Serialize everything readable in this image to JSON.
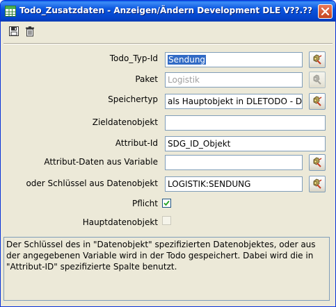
{
  "window": {
    "title": "Todo_Zusatzdaten - Anzeigen/Ändern Development DLE V??.??"
  },
  "toolbar": {
    "save_icon": "save-icon",
    "delete_icon": "trash-icon"
  },
  "form": {
    "todo_typ_id": {
      "label": "Todo_Typ-Id",
      "value": "Sendung"
    },
    "paket": {
      "label": "Paket",
      "value": "Logistik"
    },
    "speichertyp": {
      "label": "Speichertyp",
      "value": "als Hauptobjekt in DLETODO - D"
    },
    "zieldatenobjekt": {
      "label": "Zieldatenobjekt",
      "value": ""
    },
    "attribut_id": {
      "label": "Attribut-Id",
      "value": "SDG_ID_Objekt"
    },
    "attribut_daten": {
      "label": "Attribut-Daten aus Variable",
      "value": ""
    },
    "schluessel": {
      "label": "oder Schlüssel aus Datenobjekt",
      "value": "LOGISTIK:SENDUNG"
    },
    "pflicht": {
      "label": "Pflicht",
      "checked": true
    },
    "hauptdatenobjekt": {
      "label": "Hauptdatenobjekt",
      "checked": false
    }
  },
  "description": "Der Schlüssel des in \"Datenobjekt\" spezifizierten Datenobjektes, oder aus der angegebenen Variable wird in der Todo gespeichert. Dabei wird die in \"Attribut-ID\" spezifizierte Spalte benutzt."
}
